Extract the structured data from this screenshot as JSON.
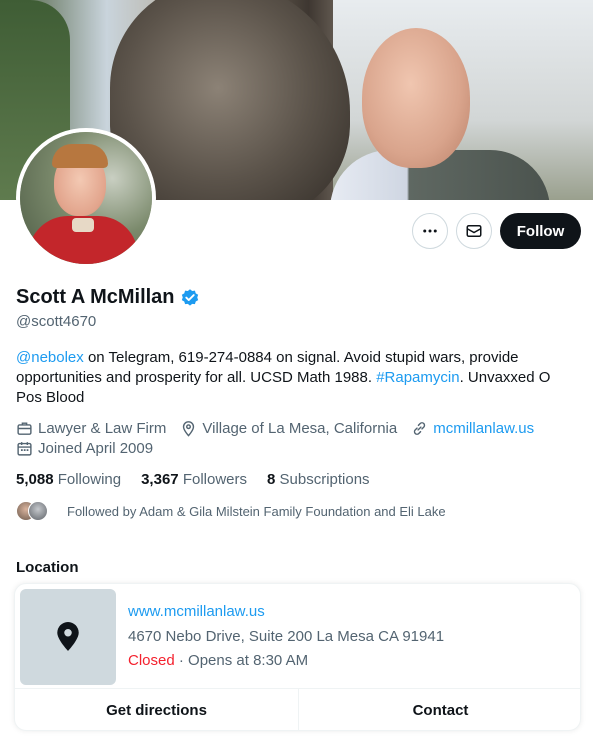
{
  "profile": {
    "name": "Scott A McMillan",
    "handle": "@scott4670",
    "follow_label": "Follow",
    "bio": {
      "mention": "@nebolex",
      "part1": " on Telegram, 619-274-0884 on signal. Avoid stupid wars, provide opportunities and prosperity for all.  UCSD Math 1988. ",
      "hashtag": "#Rapamycin",
      "part2": ". Unvaxxed O Pos Blood"
    },
    "category": "Lawyer & Law Firm",
    "location": "Village of La Mesa, California",
    "website": "mcmillanlaw.us",
    "joined": "Joined April 2009"
  },
  "stats": {
    "following_count": "5,088",
    "following_label": "Following",
    "followers_count": "3,367",
    "followers_label": "Followers",
    "subs_count": "8",
    "subs_label": "Subscriptions"
  },
  "followed_by": "Followed by Adam & Gila Milstein Family Foundation and Eli Lake",
  "location_card": {
    "section_title": "Location",
    "site": "www.mcmillanlaw.us",
    "address": "4670 Nebo Drive, Suite 200 La Mesa CA 91941",
    "status": "Closed",
    "hours": " · Opens at 8:30 AM",
    "directions_label": "Get directions",
    "contact_label": "Contact"
  },
  "colors": {
    "accent": "#1d9bf0",
    "text": "#0f1419",
    "muted": "#536471",
    "closed": "#f4212e"
  },
  "icons": {
    "more": "more-horizontal-icon",
    "mail": "mail-icon",
    "verified": "verified-badge-icon",
    "category": "briefcase-icon",
    "location": "location-pin-icon",
    "website": "link-icon",
    "joined": "calendar-icon",
    "map": "map-pin-icon"
  }
}
